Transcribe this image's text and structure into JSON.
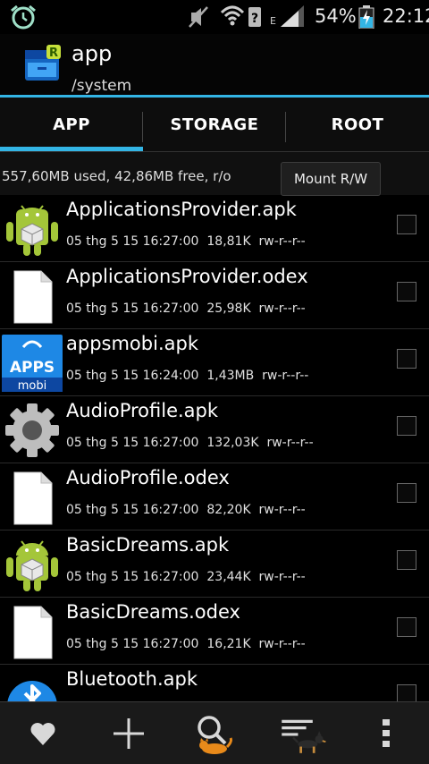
{
  "status_bar": {
    "battery_percent": "54%",
    "time": "22:12",
    "network_type": "E"
  },
  "header": {
    "title": "app",
    "path": "/system"
  },
  "tabs": [
    {
      "label": "APP",
      "selected": true
    },
    {
      "label": "STORAGE",
      "selected": false
    },
    {
      "label": "ROOT",
      "selected": false
    }
  ],
  "info": {
    "storage_text": "557,60MB used, 42,86MB free, r/o",
    "mount_button": "Mount R/W"
  },
  "files": [
    {
      "name": "ApplicationsProvider.apk",
      "date": "05 thg 5 15 16:27:00",
      "size": "18,81K",
      "perm": "rw-r--r--",
      "icon": "android-apk-icon"
    },
    {
      "name": "ApplicationsProvider.odex",
      "date": "05 thg 5 15 16:27:00",
      "size": "25,98K",
      "perm": "rw-r--r--",
      "icon": "file-icon"
    },
    {
      "name": "appsmobi.apk",
      "date": "05 thg 5 15 16:24:00",
      "size": "1,43MB",
      "perm": "rw-r--r--",
      "icon": "appsmobi-icon",
      "icon_text_top": "APPS",
      "icon_text_bottom": "mobi"
    },
    {
      "name": "AudioProfile.apk",
      "date": "05 thg 5 15 16:27:00",
      "size": "132,03K",
      "perm": "rw-r--r--",
      "icon": "settings-gear-icon"
    },
    {
      "name": "AudioProfile.odex",
      "date": "05 thg 5 15 16:27:00",
      "size": "82,20K",
      "perm": "rw-r--r--",
      "icon": "file-icon"
    },
    {
      "name": "BasicDreams.apk",
      "date": "05 thg 5 15 16:27:00",
      "size": "23,44K",
      "perm": "rw-r--r--",
      "icon": "android-apk-icon"
    },
    {
      "name": "BasicDreams.odex",
      "date": "05 thg 5 15 16:27:00",
      "size": "16,21K",
      "perm": "rw-r--r--",
      "icon": "file-icon"
    },
    {
      "name": "Bluetooth.apk",
      "date": "",
      "size": "",
      "perm": "",
      "icon": "bluetooth-icon"
    }
  ],
  "bottom_actions": [
    {
      "icon": "favorite-heart-icon"
    },
    {
      "icon": "add-plus-icon"
    },
    {
      "icon": "search-icon"
    },
    {
      "icon": "sort-icon"
    },
    {
      "icon": "overflow-menu-icon"
    }
  ],
  "colors": {
    "accent": "#33b5e5",
    "background": "#000000",
    "android_green": "#a4c639"
  }
}
